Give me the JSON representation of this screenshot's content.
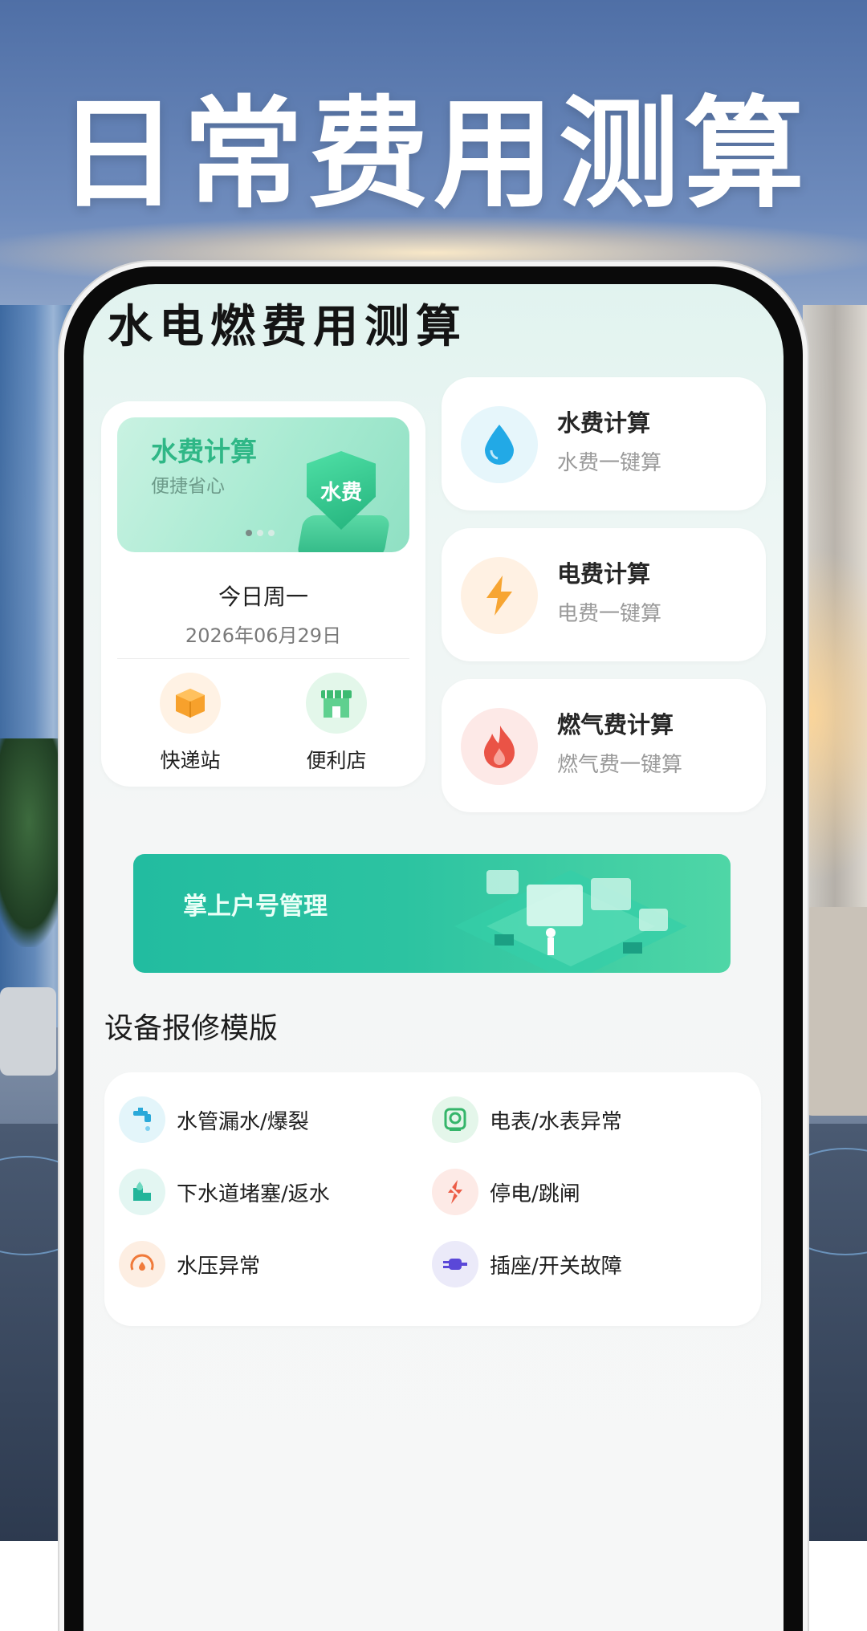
{
  "headline": "日常费用测算",
  "app": {
    "title": "水电燃费用测算"
  },
  "banner": {
    "title": "水费计算",
    "subtitle": "便捷省心",
    "badge": "水费"
  },
  "date": {
    "day": "今日周一",
    "full": "2026年06月29日"
  },
  "quick_actions": [
    {
      "label": "快递站",
      "icon": "package-icon"
    },
    {
      "label": "便利店",
      "icon": "store-icon"
    }
  ],
  "fee_cards": [
    {
      "title": "水费计算",
      "subtitle": "水费一键算",
      "icon": "water-drop-icon",
      "bg": "#e6f6fb",
      "color": "#22a9e6"
    },
    {
      "title": "电费计算",
      "subtitle": "电费一键算",
      "icon": "lightning-icon",
      "bg": "#fff1e3",
      "color": "#f7a532"
    },
    {
      "title": "燃气费计算",
      "subtitle": "燃气费一键算",
      "icon": "flame-icon",
      "bg": "#fde9e7",
      "color": "#ea5346"
    }
  ],
  "promo": {
    "label": "掌上户号管理"
  },
  "repair": {
    "section_title": "设备报修模版",
    "items": [
      {
        "label": "水管漏水/爆裂",
        "icon": "faucet-icon",
        "bg": "#e3f5fa",
        "color": "#2aa9d9"
      },
      {
        "label": "电表/水表异常",
        "icon": "meter-icon",
        "bg": "#e4f6ea",
        "color": "#35b56a"
      },
      {
        "label": "下水道堵塞/返水",
        "icon": "drain-icon",
        "bg": "#e3f6f2",
        "color": "#22b59a"
      },
      {
        "label": "停电/跳闸",
        "icon": "power-off-icon",
        "bg": "#fdeae6",
        "color": "#ec5c46"
      },
      {
        "label": "水压异常",
        "icon": "pressure-gauge-icon",
        "bg": "#fdeee2",
        "color": "#f07a3a"
      },
      {
        "label": "插座/开关故障",
        "icon": "plug-icon",
        "bg": "#ebeaf9",
        "color": "#5a48d8"
      }
    ]
  },
  "colors": {
    "accent": "#2fb786",
    "promo": "#22bca0"
  }
}
